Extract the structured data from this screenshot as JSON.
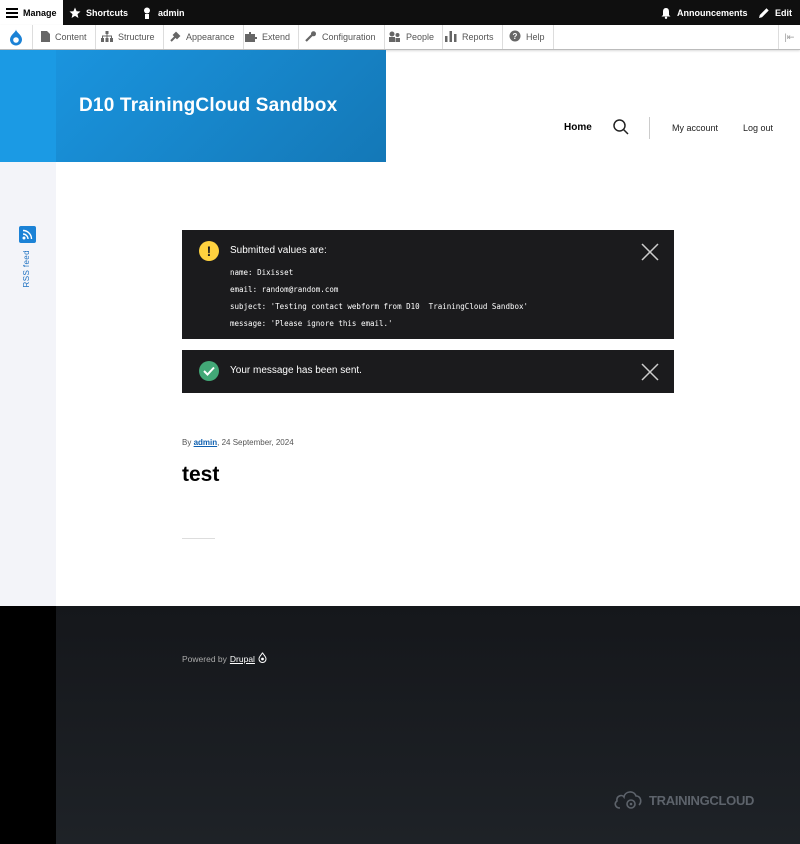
{
  "toolbar": {
    "manage": "Manage",
    "shortcuts": "Shortcuts",
    "user": "admin",
    "announcements": "Announcements",
    "edit": "Edit"
  },
  "tray": {
    "items": [
      {
        "label": "Content",
        "icon": "file-icon"
      },
      {
        "label": "Structure",
        "icon": "sitemap-icon"
      },
      {
        "label": "Appearance",
        "icon": "wrench-icon"
      },
      {
        "label": "Extend",
        "icon": "puzzle-icon"
      },
      {
        "label": "Configuration",
        "icon": "wrench-icon"
      },
      {
        "label": "People",
        "icon": "people-icon"
      },
      {
        "label": "Reports",
        "icon": "bar-chart-icon"
      },
      {
        "label": "Help",
        "icon": "help-icon"
      }
    ]
  },
  "header": {
    "site_name": "D10 TrainingCloud Sandbox",
    "nav_home": "Home",
    "my_account": "My account",
    "log_out": "Log out"
  },
  "rail": {
    "rss": "RSS feed"
  },
  "messages": {
    "warning_title": "Submitted values are:",
    "warning_lines": [
      "name: Dixisset",
      "email: random@random.com",
      "subject: 'Testing contact webform from D10  TrainingCloud Sandbox'",
      "message: 'Please ignore this email.'"
    ],
    "status_title": "Your message has been sent."
  },
  "article": {
    "by": "By",
    "author": "admin",
    "date": ", 24 September, 2024",
    "title": "test"
  },
  "footer": {
    "powered_by": "Powered by",
    "drupal": "Drupal",
    "brand": "TRAININGCLOUD"
  },
  "colors": {
    "brand_blue": "#1b9ae4",
    "message_bg": "#1b1b1d",
    "warning": "#ffd23f",
    "success": "#42a877"
  }
}
